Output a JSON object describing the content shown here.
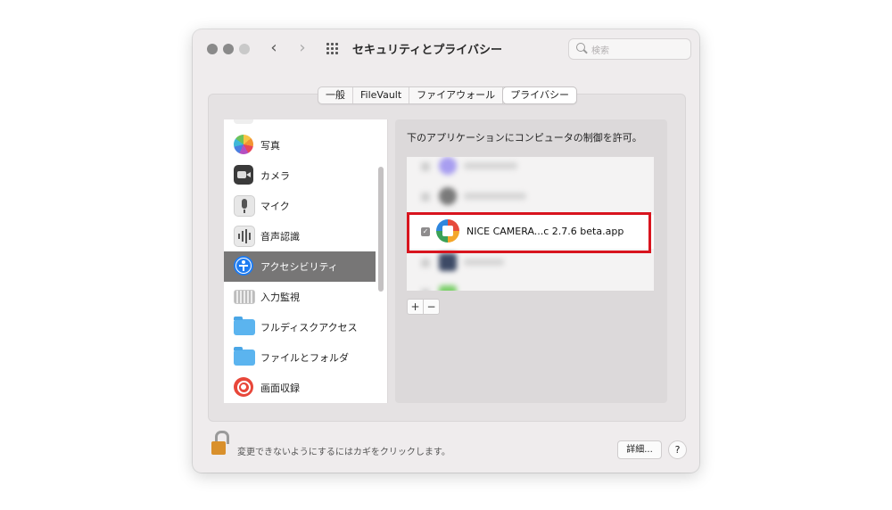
{
  "window": {
    "title": "セキュリティとプライバシー",
    "search_placeholder": "検索"
  },
  "tabs": [
    {
      "label": "一般",
      "active": false
    },
    {
      "label": "FileVault",
      "active": false
    },
    {
      "label": "ファイアウォール",
      "active": false
    },
    {
      "label": "プライバシー",
      "active": true
    }
  ],
  "sidebar": {
    "items": [
      {
        "label": "写真",
        "icon": "photos-icon"
      },
      {
        "label": "カメラ",
        "icon": "camera-icon"
      },
      {
        "label": "マイク",
        "icon": "microphone-icon"
      },
      {
        "label": "音声認識",
        "icon": "speech-recognition-icon"
      },
      {
        "label": "アクセシビリティ",
        "icon": "accessibility-icon",
        "selected": true
      },
      {
        "label": "入力監視",
        "icon": "keyboard-icon"
      },
      {
        "label": "フルディスクアクセス",
        "icon": "folder-icon"
      },
      {
        "label": "ファイルとフォルダ",
        "icon": "folder-icon"
      },
      {
        "label": "画面収録",
        "icon": "screen-record-icon"
      }
    ]
  },
  "panel": {
    "heading": "下のアプリケーションにコンピュータの制御を許可。",
    "app": {
      "name": "NICE CAMERA...c 2.7.6 beta.app",
      "checked": true
    },
    "add_label": "+",
    "remove_label": "−"
  },
  "footer": {
    "lock_text": "変更できないようにするにはカギをクリックします。",
    "details_label": "詳細...",
    "help_label": "?"
  },
  "colors": {
    "highlight": "#d8141e",
    "selected_row": "#777676",
    "lock": "#d9902c"
  }
}
